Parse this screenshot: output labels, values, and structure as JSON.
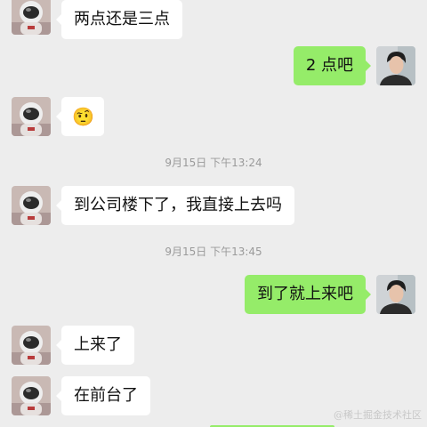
{
  "colors": {
    "background": "#ededed",
    "incoming_bubble": "#ffffff",
    "outgoing_bubble": "#95ec69",
    "timestamp_text": "#9a9a9a"
  },
  "messages": [
    {
      "side": "left",
      "text": "两点还是三点"
    },
    {
      "side": "right",
      "text": "2 点吧"
    },
    {
      "side": "left",
      "emoji": "🤨"
    },
    {
      "timestamp": "9月15日 下午13:24"
    },
    {
      "side": "left",
      "text": "到公司楼下了，我直接上去吗"
    },
    {
      "timestamp": "9月15日 下午13:45"
    },
    {
      "side": "right",
      "text": "到了就上来吧"
    },
    {
      "side": "left",
      "text": "上来了"
    },
    {
      "side": "left",
      "text": "在前台了"
    }
  ],
  "avatars": {
    "left": "astronaut-avatar",
    "right": "young-man-avatar"
  },
  "watermark": "@稀土掘金技术社区"
}
